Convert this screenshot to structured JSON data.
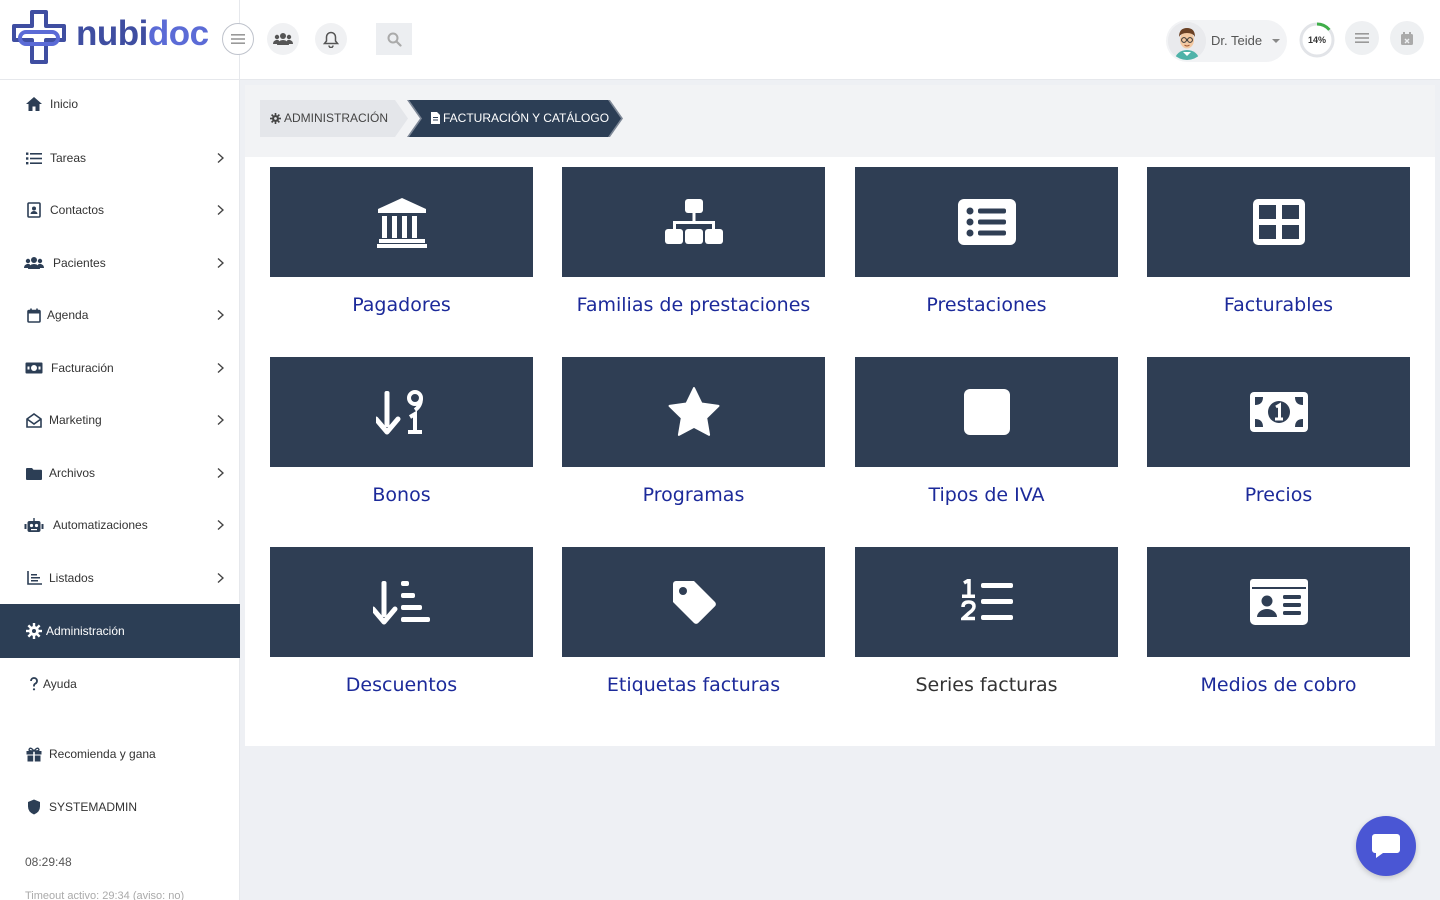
{
  "brand": {
    "part1": "nubi",
    "part2": "doc",
    "accent": "#4a56d4"
  },
  "user": {
    "name": "Dr. Teide",
    "progress_label": "14%",
    "progress": 0.14
  },
  "sidebar": {
    "items": [
      {
        "label": "Inicio",
        "icon": "home-icon"
      },
      {
        "label": "Tareas",
        "icon": "list-icon"
      },
      {
        "label": "Contactos",
        "icon": "address-book-icon"
      },
      {
        "label": "Pacientes",
        "icon": "users-icon"
      },
      {
        "label": "Agenda",
        "icon": "calendar-icon"
      },
      {
        "label": "Facturación",
        "icon": "money-icon"
      },
      {
        "label": "Marketing",
        "icon": "envelope-open-icon"
      },
      {
        "label": "Archivos",
        "icon": "folder-icon"
      },
      {
        "label": "Automatizaciones",
        "icon": "robot-icon"
      },
      {
        "label": "Listados",
        "icon": "chart-list-icon"
      },
      {
        "label": "Administración",
        "icon": "gear-icon"
      },
      {
        "label": "Ayuda",
        "icon": "question-icon"
      },
      {
        "label": "Recomienda y gana",
        "icon": "gift-icon"
      },
      {
        "label": "SYSTEMADMIN",
        "icon": "shield-icon"
      }
    ],
    "clock": "08:29:48",
    "timeout": "Timeout activo: 29:34 (aviso: no)"
  },
  "breadcrumb": {
    "level1": "ADMINISTRACIÓN",
    "level2": "FACTURACIÓN Y CATÁLOGO"
  },
  "tiles": [
    {
      "label": "Pagadores",
      "icon": "bank-icon"
    },
    {
      "label": "Familias de prestaciones",
      "icon": "sitemap-icon"
    },
    {
      "label": "Prestaciones",
      "icon": "list-alt-icon"
    },
    {
      "label": "Facturables",
      "icon": "grid-icon"
    },
    {
      "label": "Bonos",
      "icon": "sort-numeric-down-icon"
    },
    {
      "label": "Programas",
      "icon": "star-icon"
    },
    {
      "label": "Tipos de IVA",
      "icon": "square-icon"
    },
    {
      "label": "Precios",
      "icon": "money-bill-icon"
    },
    {
      "label": "Descuentos",
      "icon": "sort-amount-down-icon"
    },
    {
      "label": "Etiquetas facturas",
      "icon": "tag-icon"
    },
    {
      "label": "Series facturas",
      "icon": "numbered-list-icon"
    },
    {
      "label": "Medios de cobro",
      "icon": "id-card-icon"
    }
  ]
}
